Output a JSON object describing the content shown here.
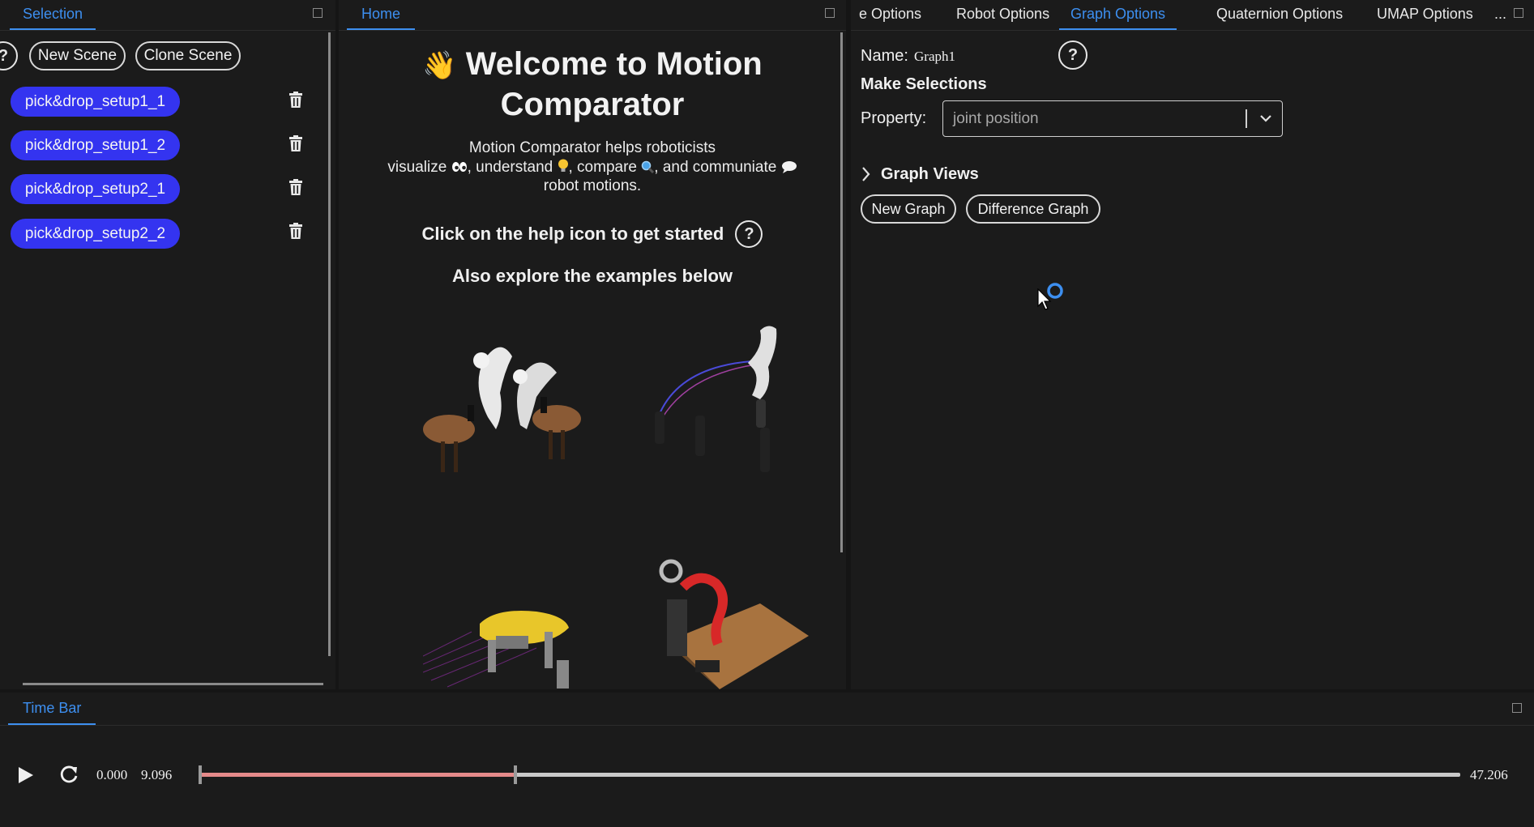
{
  "selection_panel": {
    "tab": "Selection",
    "help_glyph": "?",
    "new_scene": "New Scene",
    "clone_scene": "Clone Scene",
    "scenes": [
      {
        "label": "pick&drop_setup1_1"
      },
      {
        "label": "pick&drop_setup1_2"
      },
      {
        "label": "pick&drop_setup2_1"
      },
      {
        "label": "pick&drop_setup2_2"
      }
    ]
  },
  "home_panel": {
    "tab": "Home",
    "welcome_emoji": "👋",
    "title_line1": "Welcome to Motion",
    "title_line2": "Comparator",
    "desc_line1": "Motion Comparator helps roboticists",
    "desc_visualize": "visualize",
    "desc_understand": ", understand",
    "desc_compare": ", compare",
    "desc_communicate": ", and communiate",
    "desc_line3": "robot motions.",
    "help_prompt": "Click on the help icon to get started",
    "help_glyph": "?",
    "examples_prompt": "Also explore the examples below"
  },
  "options_panel": {
    "tabs": [
      "e Options",
      "Robot Options",
      "Graph Options",
      "Quaternion Options",
      "UMAP Options",
      "..."
    ],
    "active_tab": "Graph Options",
    "name_label": "Name:",
    "name_value": "Graph1",
    "help_glyph": "?",
    "make_selections": "Make Selections",
    "property_label": "Property:",
    "property_value": "joint position",
    "graph_views": "Graph Views",
    "new_graph": "New Graph",
    "difference_graph": "Difference Graph"
  },
  "timebar": {
    "tab": "Time Bar",
    "start_time": "0.000",
    "current_time": "9.096",
    "end_time": "47.206",
    "progress": 0.25
  },
  "colors": {
    "accent": "#3d8ff0",
    "scene_pill": "#3434f0",
    "progress_fill": "#e58a8a"
  }
}
